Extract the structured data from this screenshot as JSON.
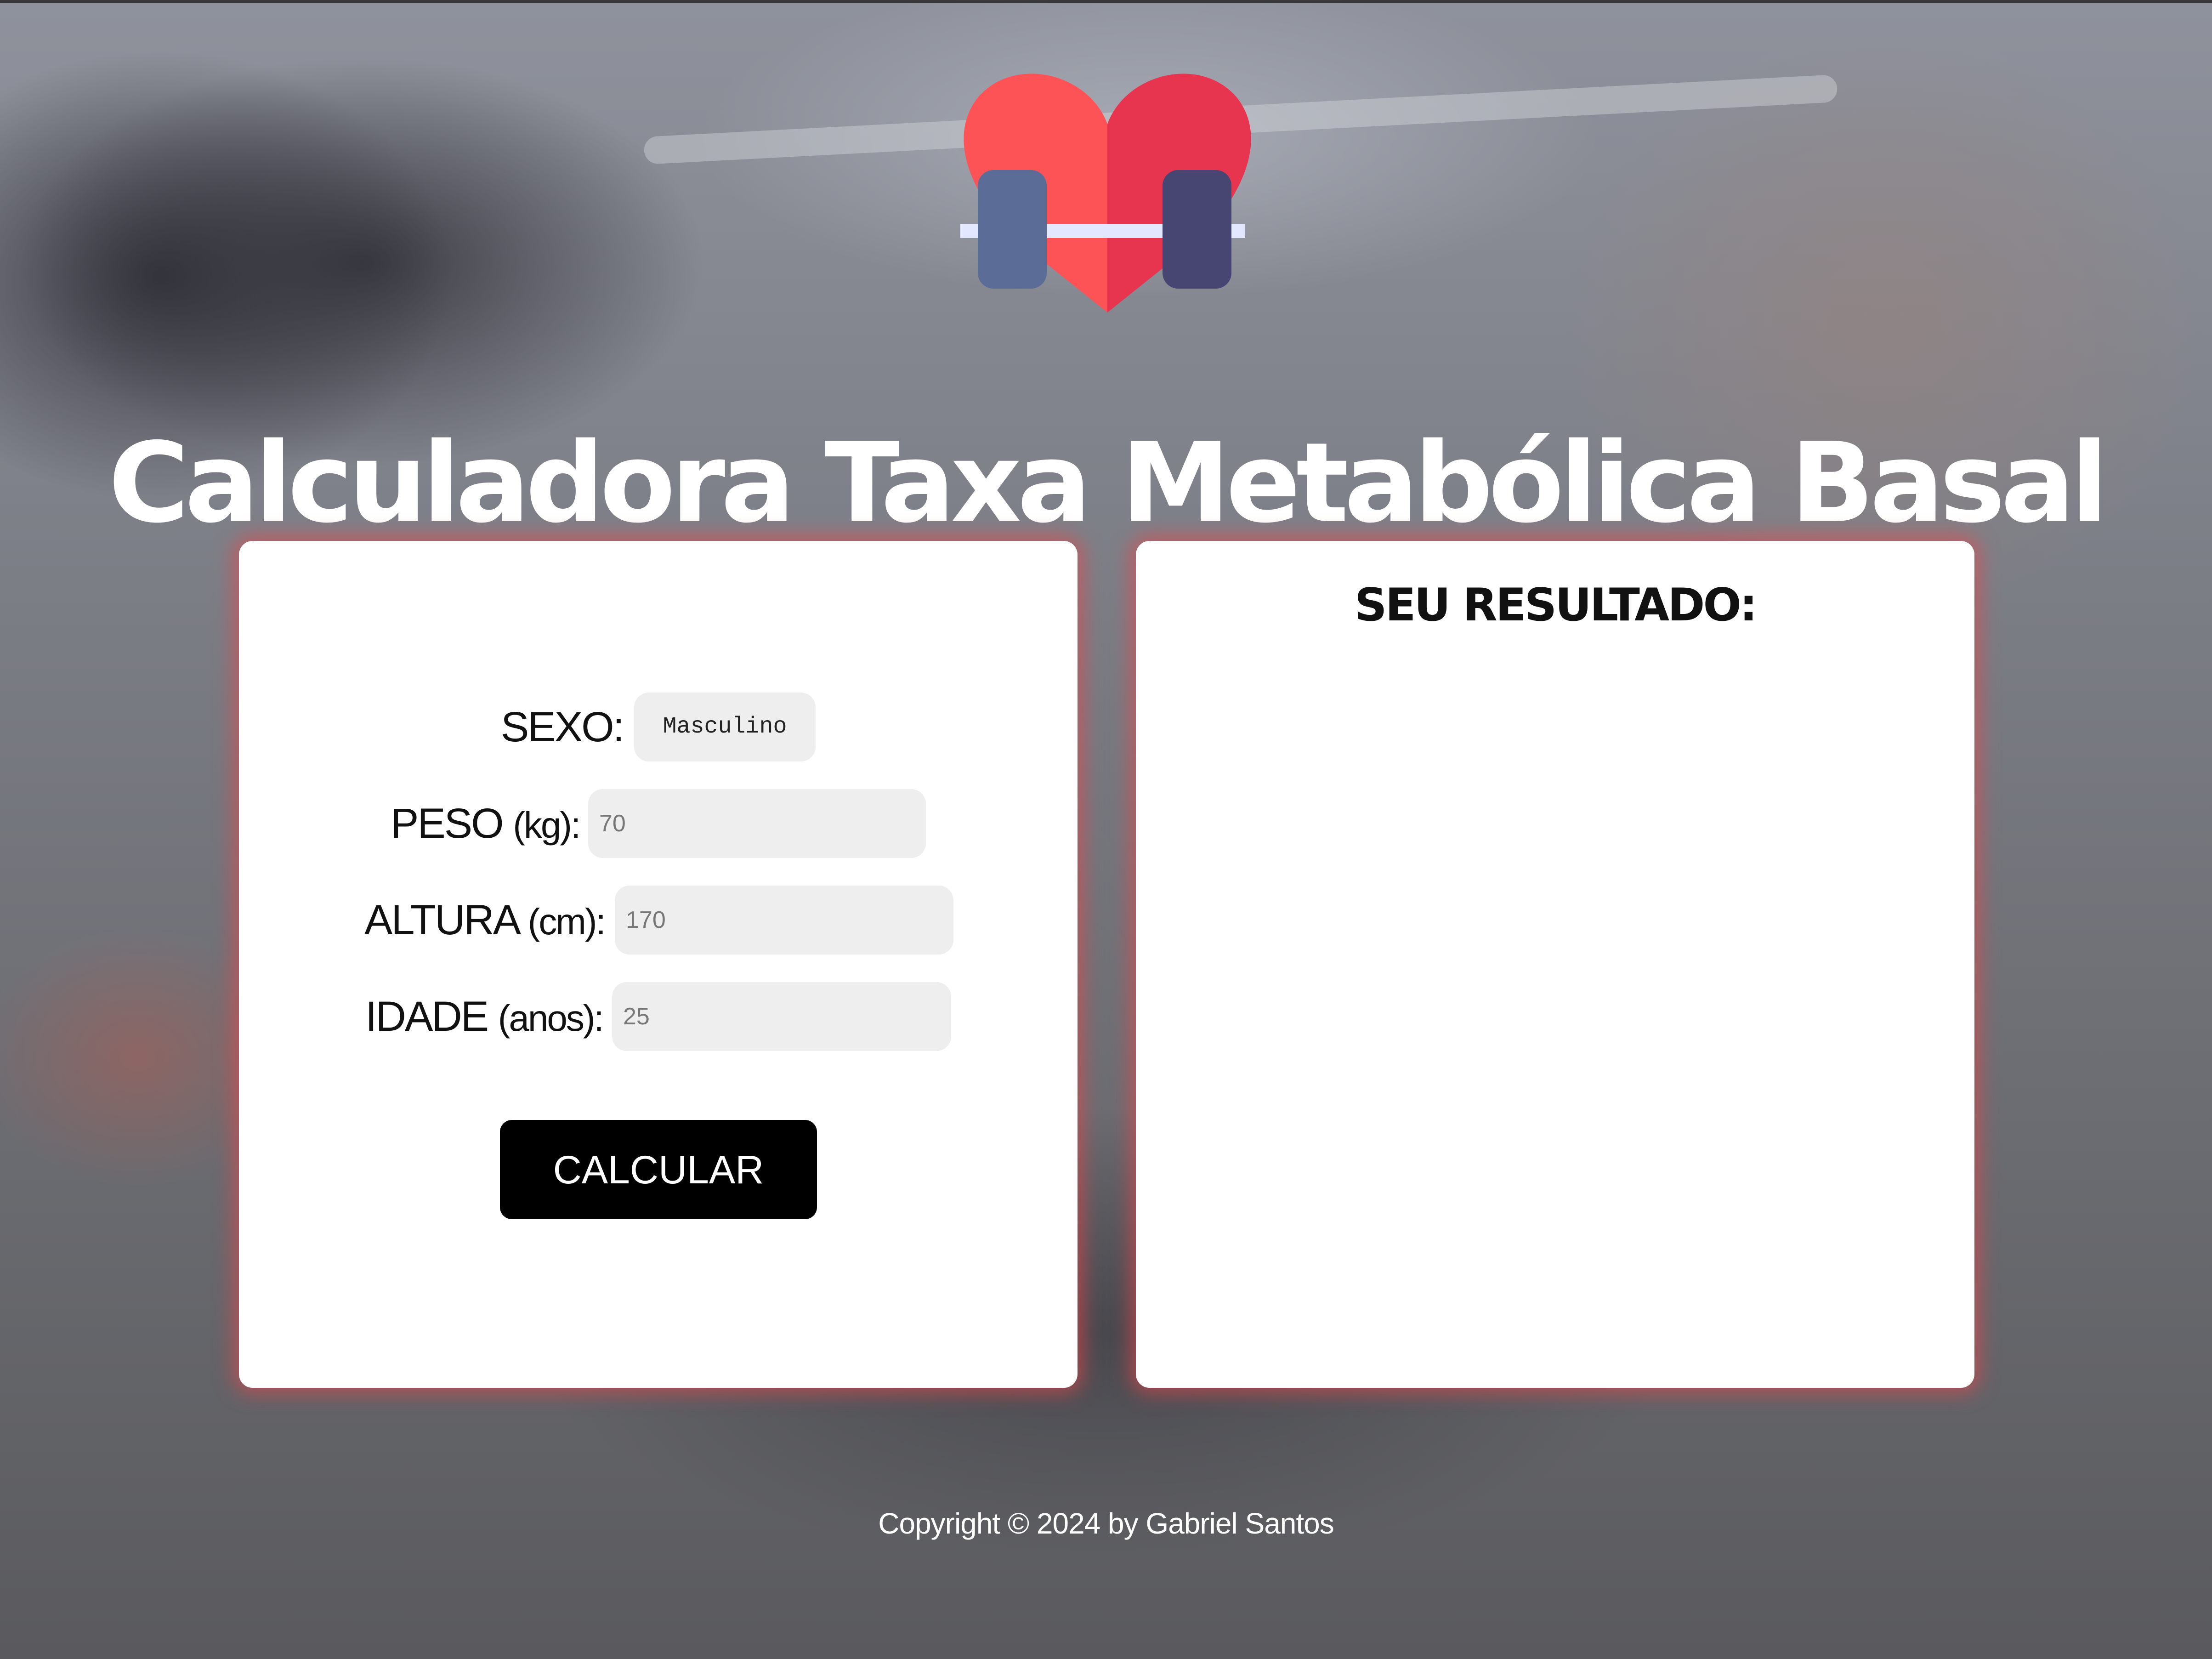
{
  "header": {
    "logo_icon": "heart-dumbbell-icon",
    "title": "Calculadora Taxa Metabólica Basal"
  },
  "form": {
    "sexo": {
      "label": "SEXO:",
      "selected": "Masculino"
    },
    "peso": {
      "label": "PESO",
      "unit": "(kg):",
      "placeholder": "70",
      "value": ""
    },
    "altura": {
      "label": "ALTURA",
      "unit": "(cm):",
      "placeholder": "170",
      "value": ""
    },
    "idade": {
      "label": "IDADE",
      "unit": "(anos):",
      "placeholder": "25",
      "value": ""
    },
    "submit_label": "CALCULAR"
  },
  "result": {
    "title": "SEU RESULTADO:",
    "content": ""
  },
  "footer": {
    "copyright": "Copyright © 2024 by Gabriel Santos"
  },
  "colors": {
    "card_glow": "#eb464b",
    "heart_left": "#fd5356",
    "heart_right": "#e7344f",
    "weight_left": "#5b6c96",
    "weight_right": "#474571",
    "bar": "#e3e7ff",
    "button": "#000000"
  }
}
